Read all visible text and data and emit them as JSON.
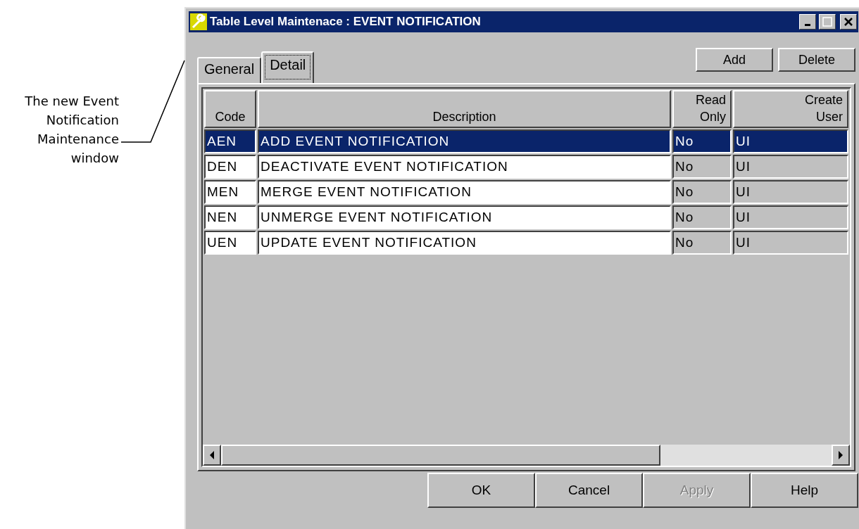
{
  "annotation": {
    "text": "The new Event Notification Maintenance window"
  },
  "window": {
    "title": "Table Level Maintenace : EVENT NOTIFICATION"
  },
  "tabs": [
    {
      "label": "General",
      "selected": false
    },
    {
      "label": "Detail",
      "selected": true
    }
  ],
  "toolbar_buttons": [
    "Add",
    "Delete"
  ],
  "table": {
    "columns": [
      "Code",
      "Description",
      "Read Only",
      "Create User"
    ],
    "rows": [
      {
        "selected": true,
        "cells": [
          "AEN",
          "ADD EVENT NOTIFICATION",
          "No",
          "UI"
        ]
      },
      {
        "selected": false,
        "cells": [
          "DEN",
          "DEACTIVATE EVENT NOTIFICATION",
          "No",
          "UI"
        ]
      },
      {
        "selected": false,
        "cells": [
          "MEN",
          "MERGE EVENT NOTIFICATION",
          "No",
          "UI"
        ]
      },
      {
        "selected": false,
        "cells": [
          "NEN",
          "UNMERGE EVENT NOTIFICATION",
          "No",
          "UI"
        ]
      },
      {
        "selected": false,
        "cells": [
          "UEN",
          "UPDATE EVENT NOTIFICATION",
          "No",
          "UI"
        ]
      }
    ]
  },
  "footer_buttons": [
    {
      "label": "OK",
      "disabled": false
    },
    {
      "label": "Cancel",
      "disabled": false
    },
    {
      "label": "Apply",
      "disabled": true
    },
    {
      "label": "Help",
      "disabled": false
    }
  ]
}
